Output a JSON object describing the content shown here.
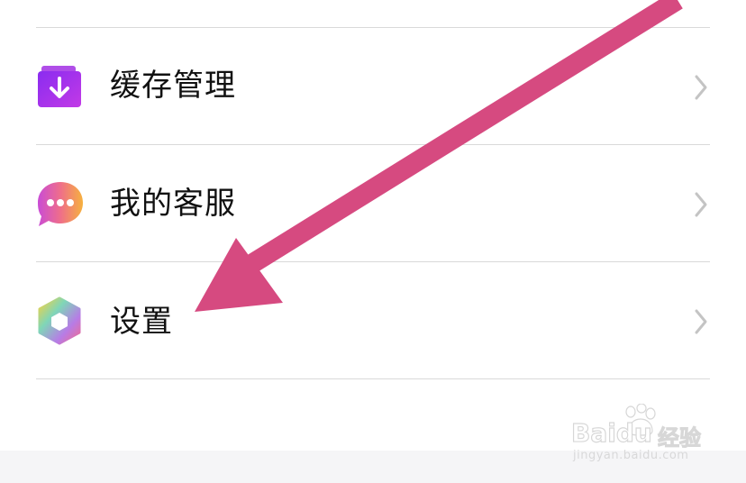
{
  "menu": {
    "items": [
      {
        "label": "缓存管理",
        "icon": "cache-download-icon"
      },
      {
        "label": "我的客服",
        "icon": "customer-service-chat-icon"
      },
      {
        "label": "设置",
        "icon": "settings-hexagon-icon"
      }
    ]
  },
  "colors": {
    "divider": "#d9d9d9",
    "chevron": "#c4c4c4",
    "annotation_arrow": "#d64a80",
    "footer_band": "#f5f5f7"
  },
  "watermark": {
    "brand": "Baidu",
    "product": "经验",
    "url": "jingyan.baidu.com"
  }
}
